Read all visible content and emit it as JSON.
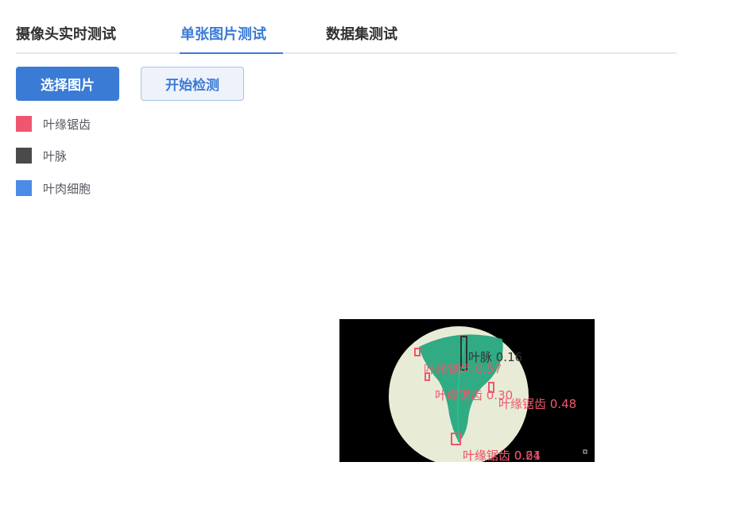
{
  "tabs": [
    {
      "label": "摄像头实时测试",
      "active": false
    },
    {
      "label": "单张图片测试",
      "active": true
    },
    {
      "label": "数据集测试",
      "active": false
    }
  ],
  "buttons": {
    "select_image": "选择图片",
    "start_detect": "开始检测"
  },
  "legend": [
    {
      "label": "叶缘锯齿",
      "color": "#f0566e"
    },
    {
      "label": "叶脉",
      "color": "#4a4a4a"
    },
    {
      "label": "叶肉细胞",
      "color": "#4a8be8"
    }
  ],
  "colors": {
    "accent": "#3a7bd5",
    "leaf": "#1fa57c",
    "disc": "#e8ecd6"
  },
  "detections": [
    {
      "label": "叶脉 0.16",
      "class": "叶脉"
    },
    {
      "label": "叶缘锯齿 0.57",
      "class": "叶缘锯齿"
    },
    {
      "label": "叶缘锯齿 0.30",
      "class": "叶缘锯齿"
    },
    {
      "label": "叶缘锯齿 0.48",
      "class": "叶缘锯齿"
    },
    {
      "label": "叶缘锯齿 0.24",
      "class": "叶缘锯齿"
    },
    {
      "label": "叶缘锯齿 0.61",
      "class": "叶缘锯齿"
    }
  ]
}
